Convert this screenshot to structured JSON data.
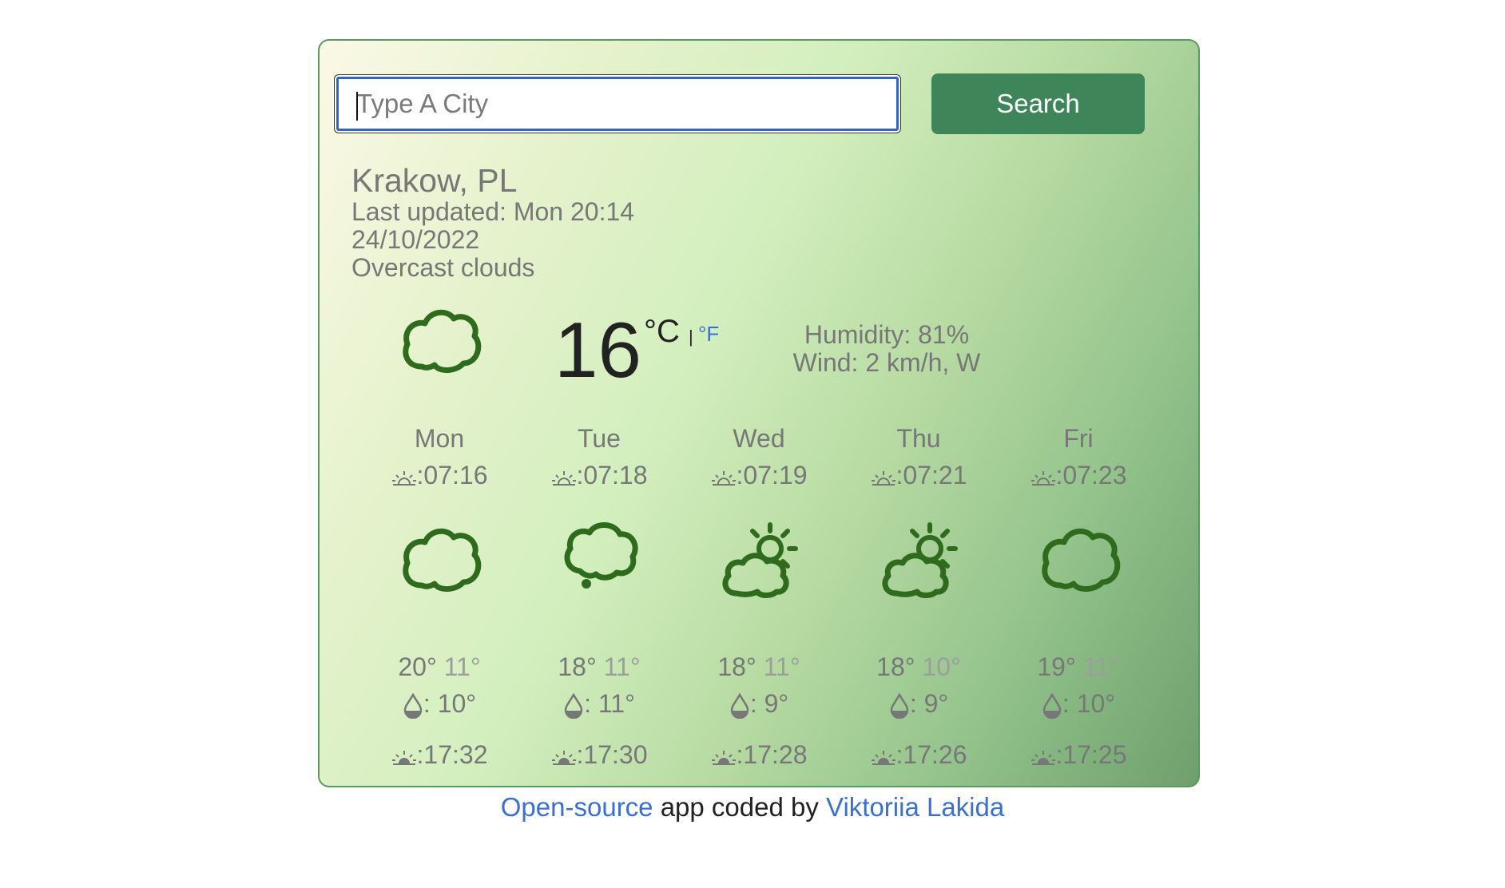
{
  "search": {
    "placeholder": "Type A City",
    "button_label": "Search"
  },
  "current": {
    "city": "Krakow, PL",
    "last_updated": "Last updated: Mon 20:14",
    "date": "24/10/2022",
    "description": "Overcast clouds",
    "icon": "cloud-icon",
    "temperature": "16",
    "unit_celsius": "°C",
    "unit_separator": "|",
    "unit_fahrenheit": "°F",
    "humidity": "Humidity: 81%",
    "wind": "Wind: 2 km/h, W"
  },
  "forecast": [
    {
      "day": "Mon",
      "sunrise": ":07:16",
      "icon": "cloud-icon",
      "max": "20°",
      "min": "11°",
      "dew": ": 10°",
      "sunset": ":17:32"
    },
    {
      "day": "Tue",
      "sunrise": ":07:18",
      "icon": "cloud-drizzle-icon",
      "max": "18°",
      "min": "11°",
      "dew": ": 11°",
      "sunset": ":17:30"
    },
    {
      "day": "Wed",
      "sunrise": ":07:19",
      "icon": "partly-sunny-icon",
      "max": "18°",
      "min": "11°",
      "dew": ": 9°",
      "sunset": ":17:28"
    },
    {
      "day": "Thu",
      "sunrise": ":07:21",
      "icon": "partly-sunny-icon",
      "max": "18°",
      "min": "10°",
      "dew": ": 9°",
      "sunset": ":17:26"
    },
    {
      "day": "Fri",
      "sunrise": ":07:23",
      "icon": "cloud-icon",
      "max": "19°",
      "min": "11°",
      "dew": ": 10°",
      "sunset": ":17:25"
    }
  ],
  "footer": {
    "link1": "Open-source",
    "middle": " app coded by ",
    "link2": "Viktoriia Lakida"
  },
  "colors": {
    "accent_button": "#3e8559",
    "icon_green": "#2f6b1c",
    "link_blue": "#3b6fd4"
  }
}
